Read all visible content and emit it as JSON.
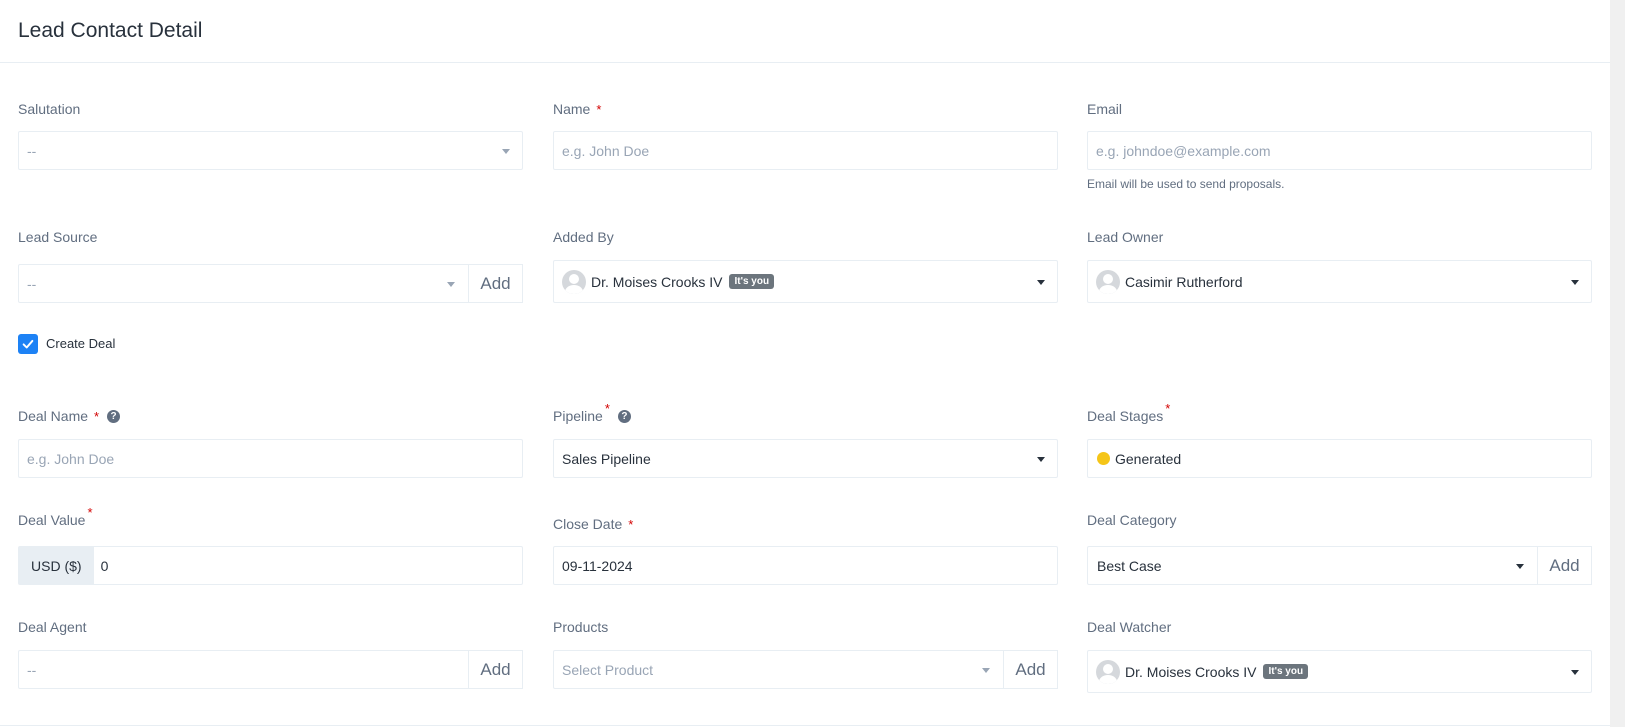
{
  "page": {
    "title": "Lead Contact Detail"
  },
  "form": {
    "salutation": {
      "label": "Salutation",
      "value": "--"
    },
    "name": {
      "label": "Name",
      "required": "*",
      "placeholder": "e.g. John Doe"
    },
    "email": {
      "label": "Email",
      "placeholder": "e.g. johndoe@example.com",
      "help": "Email will be used to send proposals."
    },
    "lead_source": {
      "label": "Lead Source",
      "value": "--",
      "add_label": "Add"
    },
    "added_by": {
      "label": "Added By",
      "value": "Dr. Moises Crooks IV",
      "badge": "It's you"
    },
    "lead_owner": {
      "label": "Lead Owner",
      "value": "Casimir Rutherford"
    },
    "create_deal": {
      "label": "Create Deal",
      "checked": true
    },
    "deal_name": {
      "label": "Deal Name",
      "required": "*",
      "placeholder": "e.g. John Doe",
      "help_icon": "question-circle-icon"
    },
    "pipeline": {
      "label": "Pipeline",
      "required": "*",
      "value": "Sales Pipeline",
      "help_icon": "question-circle-icon"
    },
    "deal_stages": {
      "label": "Deal Stages",
      "required": "*",
      "value": "Generated",
      "dot_color": "#f5c518"
    },
    "deal_value": {
      "label": "Deal Value",
      "required": "*",
      "currency": "USD ($)",
      "value": "0"
    },
    "close_date": {
      "label": "Close Date",
      "required": "*",
      "value": "09-11-2024"
    },
    "deal_category": {
      "label": "Deal Category",
      "value": "Best Case",
      "add_label": "Add"
    },
    "deal_agent": {
      "label": "Deal Agent",
      "value": "--",
      "add_label": "Add"
    },
    "products": {
      "label": "Products",
      "placeholder": "Select Product",
      "add_label": "Add"
    },
    "deal_watcher": {
      "label": "Deal Watcher",
      "value": "Dr. Moises Crooks IV",
      "badge": "It's you"
    }
  },
  "colors": {
    "accent": "#1d82f5",
    "label": "#616e80",
    "border": "#e8eef3",
    "required": "#d30000"
  }
}
